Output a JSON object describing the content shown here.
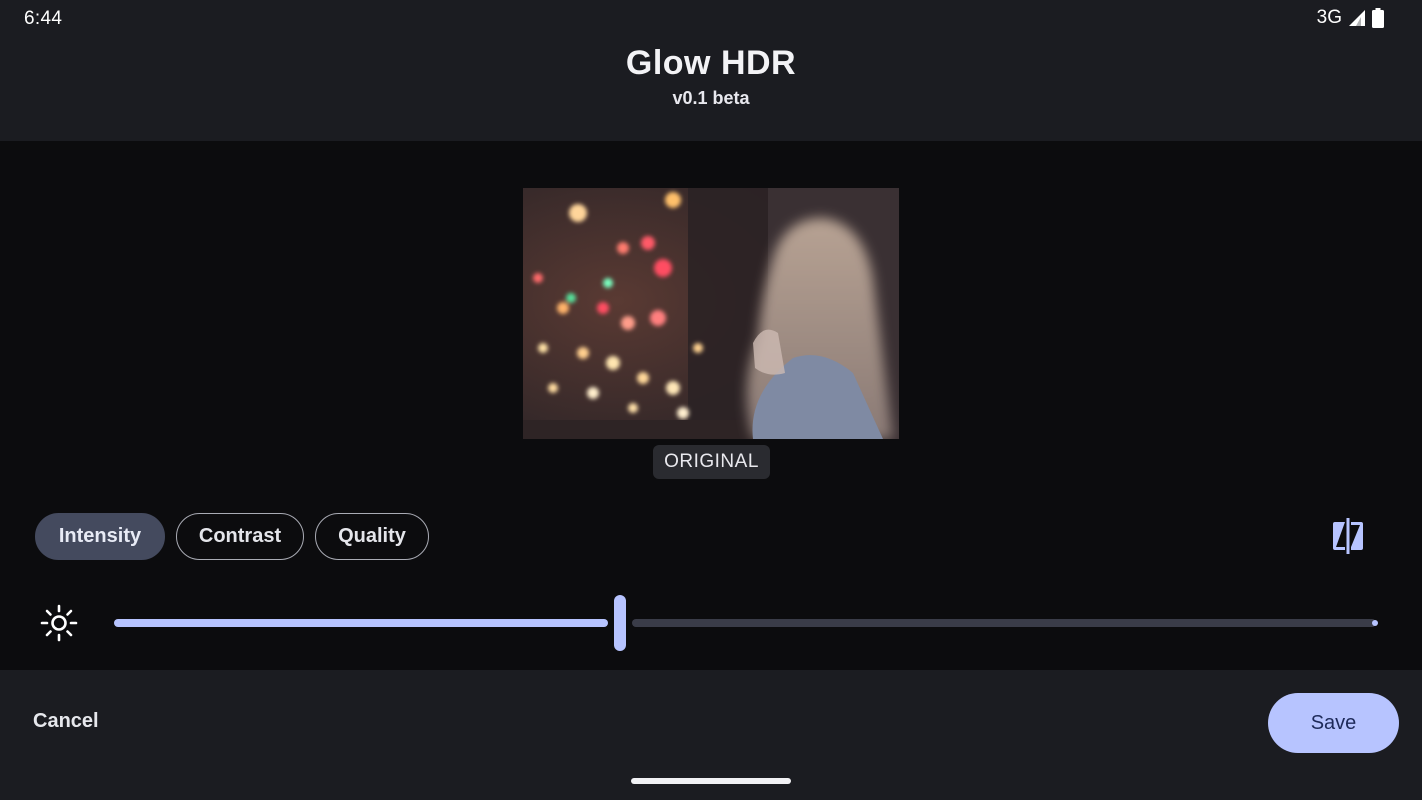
{
  "status_bar": {
    "time": "6:44",
    "network": "3G",
    "icons": [
      "signal-icon",
      "battery-icon"
    ]
  },
  "header": {
    "title": "Glow HDR",
    "subtitle": "v0.1 beta"
  },
  "preview": {
    "label": "ORIGINAL"
  },
  "controls": {
    "chips": [
      {
        "label": "Intensity",
        "selected": true
      },
      {
        "label": "Contrast",
        "selected": false
      },
      {
        "label": "Quality",
        "selected": false
      }
    ],
    "compare_icon": "compare-icon",
    "slider_icon": "brightness-icon",
    "slider_value": 0.4
  },
  "bottom_bar": {
    "cancel_label": "Cancel",
    "save_label": "Save"
  },
  "colors": {
    "accent": "#b7c4ff",
    "chip_active": "#444a5e",
    "track_inactive": "#3a3c48",
    "surface": "#1b1c21",
    "background": "#0c0c0e"
  }
}
